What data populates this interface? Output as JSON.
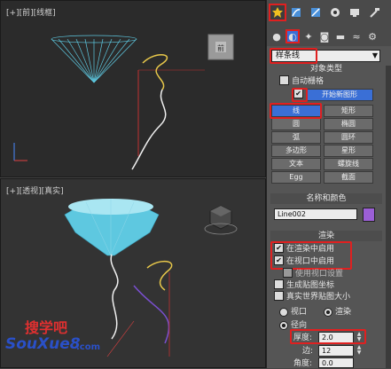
{
  "viewport_top": {
    "label": "[+][前][线框]"
  },
  "viewport_persp": {
    "label": "[+][透视][真实]"
  },
  "panel": {
    "dropdown_value": "样条线",
    "object_type": {
      "title": "对象类型",
      "auto_grid": "自动栅格",
      "start_new_shape": "开始新图形",
      "buttons": [
        "线",
        "矩形",
        "圆",
        "椭圆",
        "弧",
        "圆环",
        "多边形",
        "星形",
        "文本",
        "螺旋线",
        "Egg",
        "截面"
      ]
    },
    "name_color": {
      "title": "名称和颜色",
      "name_value": "Line002",
      "color": "#9b5fd6"
    },
    "rendering": {
      "title": "渲染",
      "enable_render": "在渲染中启用",
      "enable_viewport": "在视口中启用",
      "use_viewport_settings": "使用视口设置",
      "gen_mapping": "生成贴图坐标",
      "real_world_map": "真实世界贴图大小",
      "viewport_radio": "视口",
      "render_radio": "渲染",
      "radial": "径向",
      "thickness_label": "厚度:",
      "thickness_value": "2.0",
      "sides_label": "边:",
      "sides_value": "12",
      "angle_label": "角度:",
      "angle_value": "0.0"
    }
  },
  "watermark": {
    "line1": "搜学吧",
    "line2": "SouXue8",
    "line3": ".com"
  },
  "colors": {
    "accent_red": "#e02020",
    "cone_cyan": "#5ec8e0",
    "spline_yellow": "#e8c84a",
    "spline_white": "#f0f0f0",
    "spline_purple": "#7a4fd0"
  }
}
